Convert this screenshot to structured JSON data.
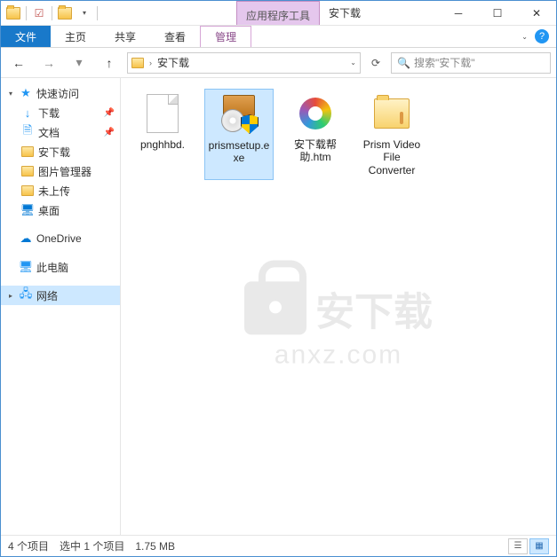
{
  "titlebar": {
    "contextual_tab": "应用程序工具",
    "window_title": "安下载"
  },
  "ribbon": {
    "file": "文件",
    "home": "主页",
    "share": "共享",
    "view": "查看",
    "manage": "管理"
  },
  "address": {
    "crumb": "安下载"
  },
  "search": {
    "placeholder": "搜索\"安下载\""
  },
  "sidebar": {
    "quick_access": "快速访问",
    "downloads": "下载",
    "documents": "文档",
    "anxiazai": "安下载",
    "picmgr": "图片管理器",
    "unupload": "未上传",
    "desktop": "桌面",
    "onedrive": "OneDrive",
    "thispc": "此电脑",
    "network": "网络"
  },
  "files": [
    {
      "name": "pnghhbd."
    },
    {
      "name": "prismsetup.exe"
    },
    {
      "name": "安下载帮助.htm"
    },
    {
      "name": "Prism Video File Converter"
    }
  ],
  "watermark": {
    "cn": "安下载",
    "url": "anxz.com"
  },
  "status": {
    "count": "4 个项目",
    "selected": "选中 1 个项目",
    "size": "1.75 MB"
  }
}
